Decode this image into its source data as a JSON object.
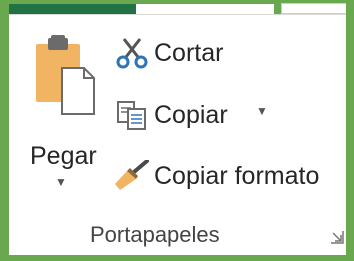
{
  "ribbon": {
    "group_name": "Portapapeles",
    "paste": {
      "label": "Pegar",
      "icon": "clipboard-paste-icon"
    },
    "commands": [
      {
        "id": "cut",
        "label": "Cortar",
        "icon": "scissors-icon"
      },
      {
        "id": "copy",
        "label": "Copiar",
        "icon": "copy-icon",
        "has_dropdown": true
      },
      {
        "id": "format_painter",
        "label": "Copiar formato",
        "icon": "paintbrush-icon"
      }
    ]
  },
  "colors": {
    "frame": "#6aa84f",
    "active_tab": "#217346",
    "clipboard": "#f0b463",
    "scissors_handle": "#2e75b6"
  }
}
